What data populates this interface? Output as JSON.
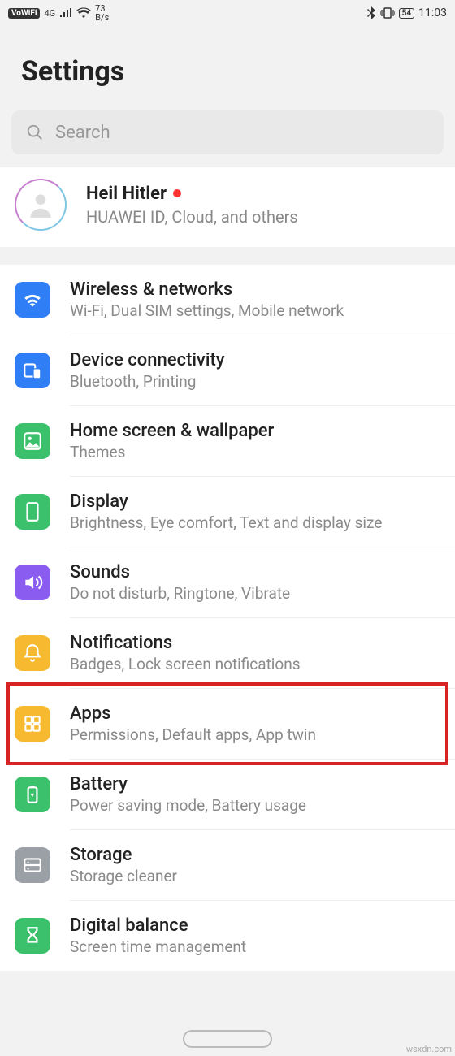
{
  "status_bar": {
    "vowifi": "VoWiFi",
    "net_label": "4G",
    "data_rate_top": "73",
    "data_rate_bottom": "B/s",
    "battery": "54",
    "time": "11:03"
  },
  "page_title": "Settings",
  "search": {
    "placeholder": "Search"
  },
  "account": {
    "name": "Heil Hitler",
    "subtitle": "HUAWEI ID, Cloud, and others"
  },
  "items": [
    {
      "id": "wireless",
      "title": "Wireless & networks",
      "subtitle": "Wi-Fi, Dual SIM settings, Mobile network",
      "color": "#2f7ef6",
      "icon": "wifi"
    },
    {
      "id": "device-conn",
      "title": "Device connectivity",
      "subtitle": "Bluetooth, Printing",
      "color": "#2f7ef6",
      "icon": "devices"
    },
    {
      "id": "home-wall",
      "title": "Home screen & wallpaper",
      "subtitle": "Themes",
      "color": "#3bc06b",
      "icon": "wallpaper"
    },
    {
      "id": "display",
      "title": "Display",
      "subtitle": "Brightness, Eye comfort, Text and display size",
      "color": "#3bc06b",
      "icon": "display"
    },
    {
      "id": "sounds",
      "title": "Sounds",
      "subtitle": "Do not disturb, Ringtone, Vibrate",
      "color": "#8a5cf0",
      "icon": "sound"
    },
    {
      "id": "notifications",
      "title": "Notifications",
      "subtitle": "Badges, Lock screen notifications",
      "color": "#f6b92f",
      "icon": "bell"
    },
    {
      "id": "apps",
      "title": "Apps",
      "subtitle": "Permissions, Default apps, App twin",
      "color": "#f6b92f",
      "icon": "apps",
      "highlighted": true
    },
    {
      "id": "battery",
      "title": "Battery",
      "subtitle": "Power saving mode, Battery usage",
      "color": "#3bc06b",
      "icon": "battery"
    },
    {
      "id": "storage",
      "title": "Storage",
      "subtitle": "Storage cleaner",
      "color": "#9aa0a6",
      "icon": "storage"
    },
    {
      "id": "digital",
      "title": "Digital balance",
      "subtitle": "Screen time management",
      "color": "#3bc06b",
      "icon": "hourglass"
    }
  ],
  "watermark": "wsxdn.com"
}
